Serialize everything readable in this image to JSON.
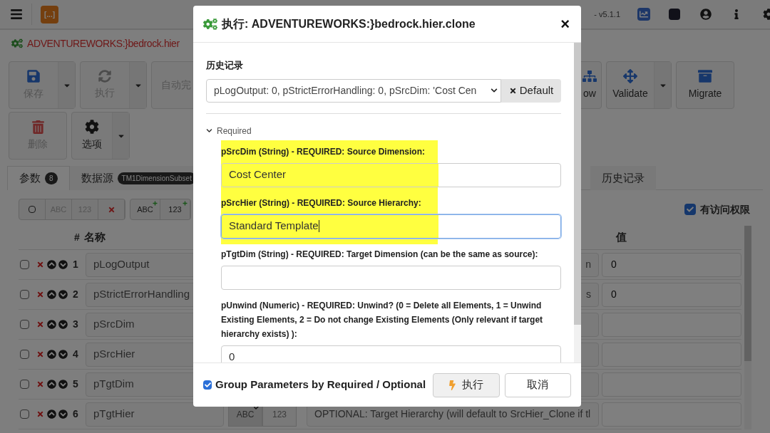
{
  "top_bar": {
    "logo": "[...]",
    "version": "- v5.1.1"
  },
  "process_title": "ADVENTUREWORKS:}bedrock.hier",
  "toolbar_left": [
    {
      "label": "保存",
      "kind": "save",
      "dropdown": true,
      "disabled": true
    },
    {
      "label": "执行",
      "kind": "run",
      "dropdown": true,
      "disabled": true
    },
    {
      "label": "自动完",
      "kind": "plain",
      "dropdown": false,
      "disabled": true
    }
  ],
  "toolbar_left_row2": [
    {
      "label": "删除",
      "kind": "delete",
      "dropdown": false,
      "disabled": true
    },
    {
      "label": "选项",
      "kind": "options",
      "dropdown": true,
      "disabled": false
    }
  ],
  "toolbar_right": [
    {
      "label": "ow",
      "kind": "tree",
      "dropdown": false,
      "disabled": false
    },
    {
      "label": "Validate",
      "kind": "validate",
      "dropdown": true,
      "disabled": false
    },
    {
      "label": "Migrate",
      "kind": "migrate",
      "dropdown": false,
      "disabled": false
    }
  ],
  "tabs": [
    {
      "label": "参数",
      "badge": "8",
      "selected": true
    },
    {
      "label": "数据源",
      "badge": "TM1DimensionSubset",
      "selected": false
    },
    {
      "label": "历史记录",
      "selected": false
    }
  ],
  "param_toolbar": [
    {
      "kind": "select-all"
    },
    {
      "kind": "text",
      "label": "ABC"
    },
    {
      "kind": "text",
      "label": "123"
    },
    {
      "kind": "delete"
    }
  ],
  "param_toolbar_add": [
    {
      "label": "ABC"
    },
    {
      "label": "123"
    }
  ],
  "access": {
    "label": "有访问权限",
    "checked": true
  },
  "table": {
    "columns": [
      "#",
      "名称",
      "值"
    ],
    "rows": [
      {
        "checked": false,
        "number": "1",
        "name": "pLogOutput",
        "description": "n",
        "value": "0"
      },
      {
        "checked": false,
        "number": "2",
        "name": "pStrictErrorHandling",
        "description": "s",
        "value": "0"
      },
      {
        "checked": false,
        "number": "3",
        "name": "pSrcDim"
      },
      {
        "checked": false,
        "number": "4",
        "name": "pSrcHier"
      },
      {
        "checked": false,
        "number": "5",
        "name": "pTgtDim"
      },
      {
        "checked": false,
        "number": "6",
        "name": "pTgtHier",
        "types": [
          {
            "label": "ABC",
            "selected": true
          },
          {
            "label": "123",
            "selected": false
          }
        ],
        "description": "OPTIONAL: Target Hierarchy (will default to SrcHier_Clone if tl"
      }
    ]
  },
  "dialog": {
    "title": "执行: ADVENTUREWORKS:}bedrock.hier.clone",
    "close": "×",
    "history_label": "历史记录",
    "history_value": "pLogOutput: 0, pStrictErrorHandling: 0, pSrcDim: 'Cost Cen",
    "default_button": "Default",
    "section": {
      "label": "Required",
      "expanded": true
    },
    "fields": [
      {
        "label": "pSrcDim (String) - REQUIRED: Source Dimension:",
        "value": "Cost Center",
        "highlighted": true,
        "focused": false
      },
      {
        "label": "pSrcHier (String) - REQUIRED: Source Hierarchy:",
        "value": "Standard Template",
        "highlighted": true,
        "focused": true
      },
      {
        "label": "pTgtDim (String) - REQUIRED: Target Dimension (can be the same as source):",
        "highlighted": false,
        "focused": false
      },
      {
        "label": "pUnwind (Numeric) - REQUIRED: Unwind? (0 = Delete all Elements, 1 = Unwind Existing Elements, 2 = Do not change Existing Elements (Only relevant if target hierarchy exists) ):",
        "value": "0",
        "highlighted": false,
        "focused": false
      }
    ],
    "group_option": {
      "label": "Group Parameters by Required / Optional",
      "checked": true
    },
    "run_button": "执行",
    "cancel_button": "取消"
  }
}
